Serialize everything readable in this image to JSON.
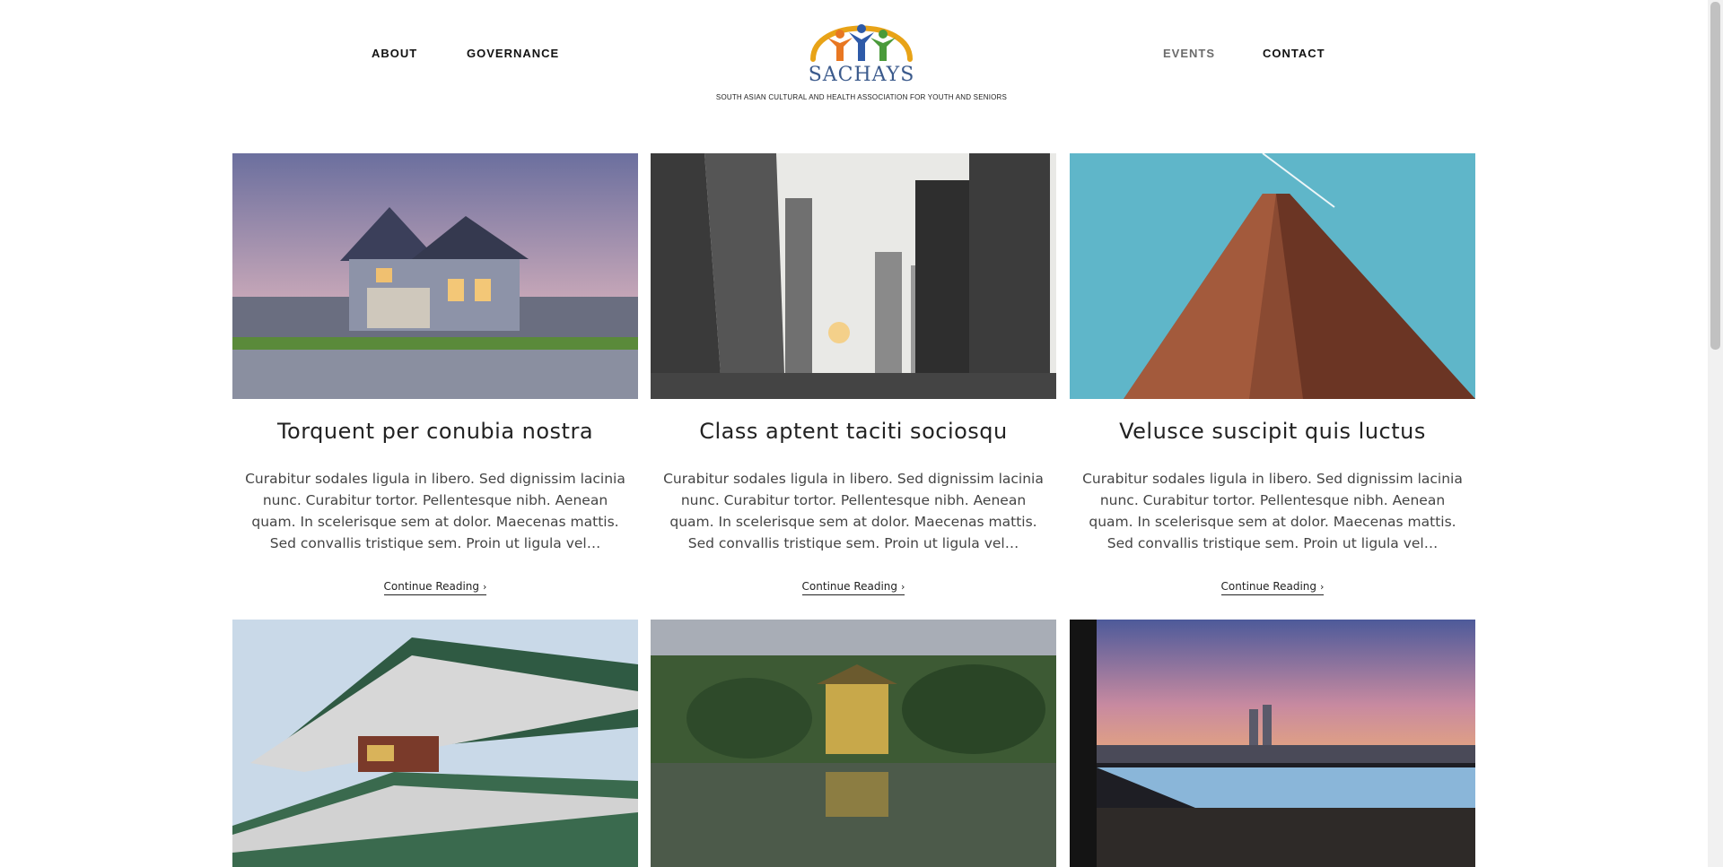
{
  "nav": {
    "left": [
      "ABOUT",
      "GOVERNANCE"
    ],
    "right": [
      "EVENTS",
      "CONTACT"
    ]
  },
  "logo": {
    "name": "SACHAYS",
    "tagline": "SOUTH ASIAN CULTURAL AND HEALTH ASSOCIATION FOR YOUTH AND SENIORS"
  },
  "posts": [
    {
      "title": "Torquent per conubia nostra",
      "excerpt": "Curabitur sodales ligula in libero. Sed dignissim lacinia nunc. Curabitur tortor. Pellentesque nibh. Aenean quam. In scelerisque sem at dolor. Maecenas mattis. Sed convallis tristique sem. Proin ut ligula vel…",
      "more": "Continue Reading",
      "image_icon": "house-photo"
    },
    {
      "title": "Class aptent taciti sociosqu",
      "excerpt": "Curabitur sodales ligula in libero. Sed dignissim lacinia nunc. Curabitur tortor. Pellentesque nibh. Aenean quam. In scelerisque sem at dolor. Maecenas mattis. Sed convallis tristique sem. Proin ut ligula vel…",
      "more": "Continue Reading",
      "image_icon": "city-street-photo"
    },
    {
      "title": "Velusce suscipit quis luctus",
      "excerpt": "Curabitur sodales ligula in libero. Sed dignissim lacinia nunc. Curabitur tortor. Pellentesque nibh. Aenean quam. In scelerisque sem at dolor. Maecenas mattis. Sed convallis tristique sem. Proin ut ligula vel…",
      "more": "Continue Reading",
      "image_icon": "skyscraper-photo"
    },
    {
      "image_icon": "pagoda-roof-photo"
    },
    {
      "image_icon": "golden-pavilion-photo"
    },
    {
      "image_icon": "infinity-pool-skyline-photo"
    }
  ],
  "colors": {
    "logo_arc": "#e8a317",
    "logo_text": "#3b5a8c",
    "figure_orange": "#e87722",
    "figure_blue": "#2e5aa8",
    "figure_green": "#4a9a3a"
  }
}
